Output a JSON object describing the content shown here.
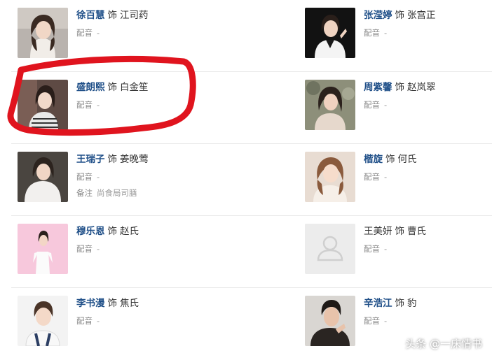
{
  "separator": "饰",
  "dub_label": "配音",
  "note_label": "备注",
  "empty_value": "-",
  "rows": [
    {
      "left": {
        "actor": "徐百慧",
        "role": "江司药",
        "dub": "-"
      },
      "right": {
        "actor": "张滢婷",
        "role": "张宫正",
        "dub": "-"
      }
    },
    {
      "left": {
        "actor": "盛朗熙",
        "role": "白金笙",
        "dub": "-"
      },
      "right": {
        "actor": "周紫馨",
        "role": "赵岚翠",
        "dub": "-"
      }
    },
    {
      "left": {
        "actor": "王瑞子",
        "role": "姜晚莺",
        "dub": "-",
        "note": "尚食局司膳"
      },
      "right": {
        "actor": "楷旋",
        "role": "何氏",
        "dub": "-"
      }
    },
    {
      "left": {
        "actor": "穆乐恩",
        "role": "赵氏",
        "dub": "-"
      },
      "right": {
        "actor": "王美妍",
        "role": "曹氏",
        "dub": "-"
      }
    },
    {
      "left": {
        "actor": "李书漫",
        "role": "焦氏",
        "dub": "-"
      },
      "right": {
        "actor": "辛浩江",
        "role": "豹",
        "dub": "-"
      }
    }
  ],
  "watermark": "头条 @一床情书",
  "colors": {
    "actor_link": "#1f4f88",
    "annotation_stroke": "#e0141e",
    "separator_line": "#e9e9e9"
  }
}
